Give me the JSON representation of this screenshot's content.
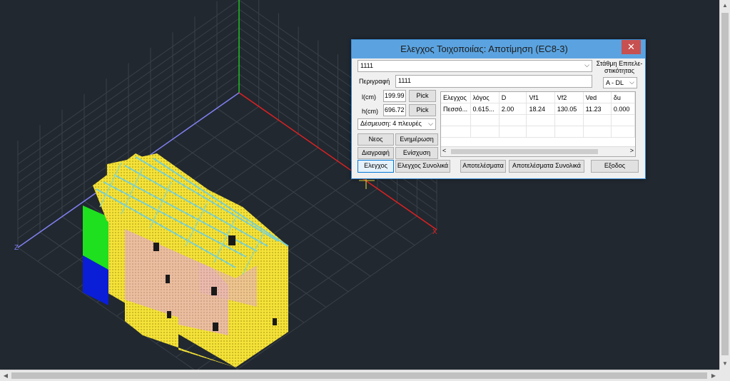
{
  "dialog": {
    "title": "Ελεγχος Τοιχοποιίας: Αποτίμηση (EC8-3)",
    "close_glyph": "✕",
    "selector": {
      "value": "1111",
      "arrow": "⌵"
    },
    "performance": {
      "label_line1": "Στάθμη Επιτελε-",
      "label_line2": "στικότητας",
      "value": "A - DL",
      "arrow": "⌵"
    },
    "description": {
      "label": "Περιγραφή",
      "value": "1111"
    },
    "length": {
      "label": "l(cm)",
      "value": "199.99",
      "pick": "Pick"
    },
    "height": {
      "label": "h(cm)",
      "value": "696.72",
      "pick": "Pick"
    },
    "restraint": {
      "value": "Δέσμευση: 4 πλευρές",
      "arrow": "⌵"
    },
    "buttons": {
      "new": "Νεος",
      "update": "Ενημέρωση",
      "delete": "Διαγραφή",
      "strengthen": "Ενίσχυση",
      "check": "Ελεγχος",
      "check_all": "Ελεγχος Συνολικά",
      "results": "Αποτελέσματα",
      "results_all": "Αποτελέσματα Συνολικά",
      "exit": "Εξοδος"
    },
    "table": {
      "columns": [
        "Ελεγχος",
        "λόγος",
        "D",
        "Vf1",
        "Vf2",
        "Ved",
        "δu"
      ],
      "rows": [
        [
          "Πεσσό...",
          "0.615...",
          "2.00",
          "18.24",
          "130.05",
          "11.23",
          "0.000"
        ]
      ],
      "scroll_left": "<",
      "scroll_right": ">"
    }
  },
  "viewport": {
    "axis_x_label": "X",
    "axis_z_label": "Z",
    "colors": {
      "background": "#212830",
      "grid": "#3a4048",
      "axis_x": "#e02020",
      "axis_y": "#20c020",
      "axis_z": "#8080f0",
      "wall": "#f5e33a",
      "wall_pink": "#e9b8b2",
      "wall_green": "#1ee01e",
      "wall_blue": "#0a1ed8",
      "roof_beam": "#7ad0d0"
    }
  },
  "scrollbars": {
    "up": "▲",
    "down": "▼",
    "left": "◀",
    "right": "▶"
  }
}
